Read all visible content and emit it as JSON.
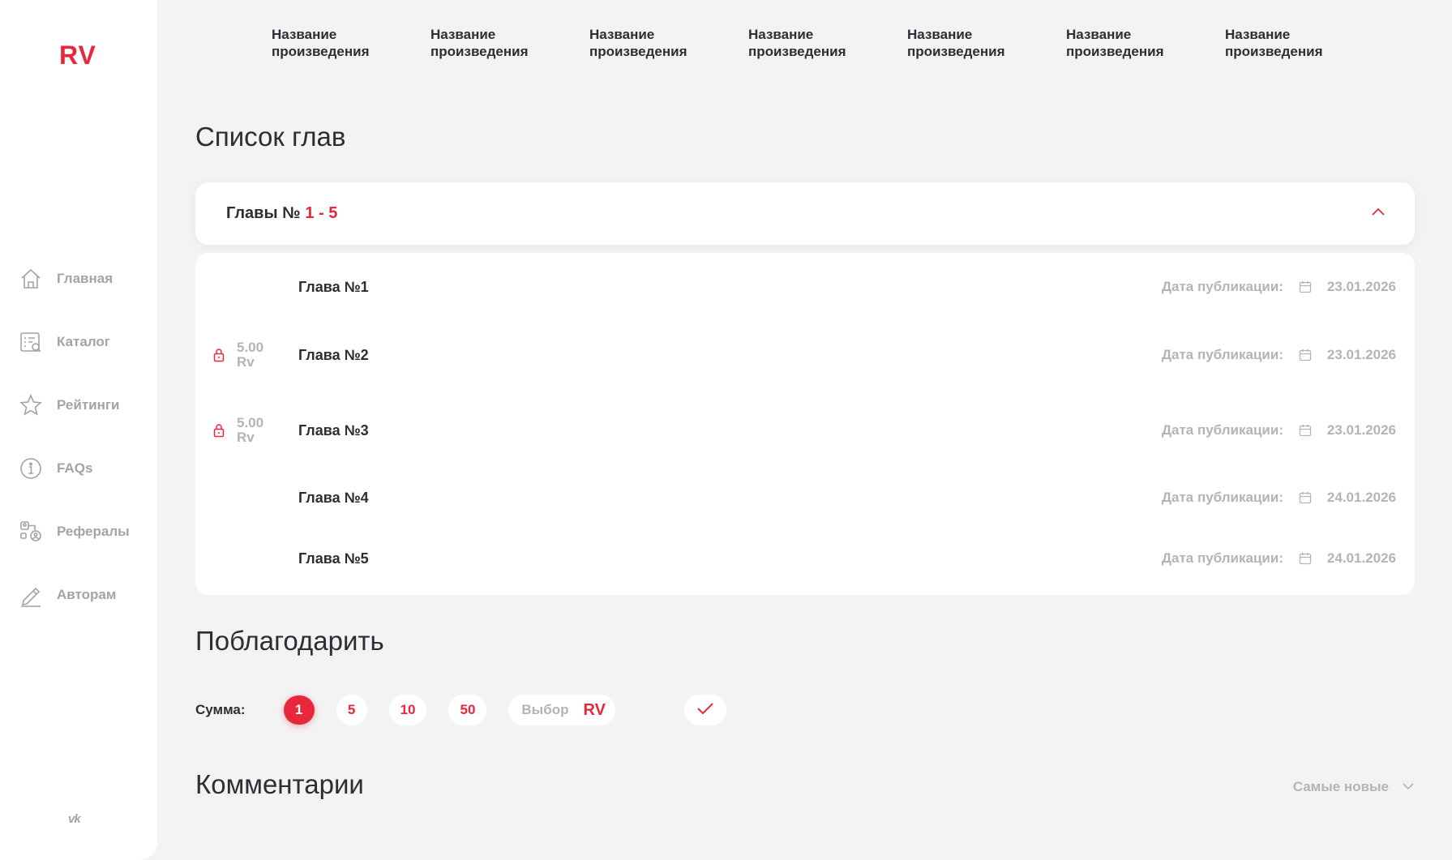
{
  "sidebar": {
    "logo": "RV",
    "items": [
      {
        "label": "Главная",
        "icon": "home-icon"
      },
      {
        "label": "Каталог",
        "icon": "catalog-icon"
      },
      {
        "label": "Рейтинги",
        "icon": "star-icon"
      },
      {
        "label": "FAQs",
        "icon": "info-icon"
      },
      {
        "label": "Рефералы",
        "icon": "referrals-icon"
      },
      {
        "label": "Авторам",
        "icon": "pencil-icon"
      }
    ],
    "social": "vk"
  },
  "header": {
    "titles": [
      "Название произведения",
      "Название произведения",
      "Название произведения",
      "Название произведения",
      "Название произведения",
      "Название произведения",
      "Название произведения"
    ]
  },
  "chapters_section": {
    "title": "Список глав",
    "accordion_label": "Главы №",
    "accordion_range": "1 - 5",
    "date_label": "Дата публикации:",
    "items": [
      {
        "name": "Глава №1",
        "price": "",
        "currency": "",
        "locked": false,
        "date": "23.01.2026"
      },
      {
        "name": "Глава №2",
        "price": "5.00",
        "currency": "Rv",
        "locked": true,
        "date": "23.01.2026"
      },
      {
        "name": "Глава №3",
        "price": "5.00",
        "currency": "Rv",
        "locked": true,
        "date": "23.01.2026"
      },
      {
        "name": "Глава №4",
        "price": "",
        "currency": "",
        "locked": false,
        "date": "24.01.2026"
      },
      {
        "name": "Глава №5",
        "price": "",
        "currency": "",
        "locked": false,
        "date": "24.01.2026"
      }
    ]
  },
  "thank_section": {
    "title": "Поблагодарить",
    "sum_label": "Сумма:",
    "amounts": [
      "1",
      "5",
      "10",
      "50"
    ],
    "selected": "1",
    "custom_placeholder": "Выбор",
    "custom_currency": "RV"
  },
  "comments_section": {
    "title": "Комментарии",
    "sort_label": "Самые новые"
  },
  "colors": {
    "accent": "#e8283a",
    "background": "#f3f3f3",
    "muted": "#b4b4b8",
    "text": "#2d2d33"
  }
}
